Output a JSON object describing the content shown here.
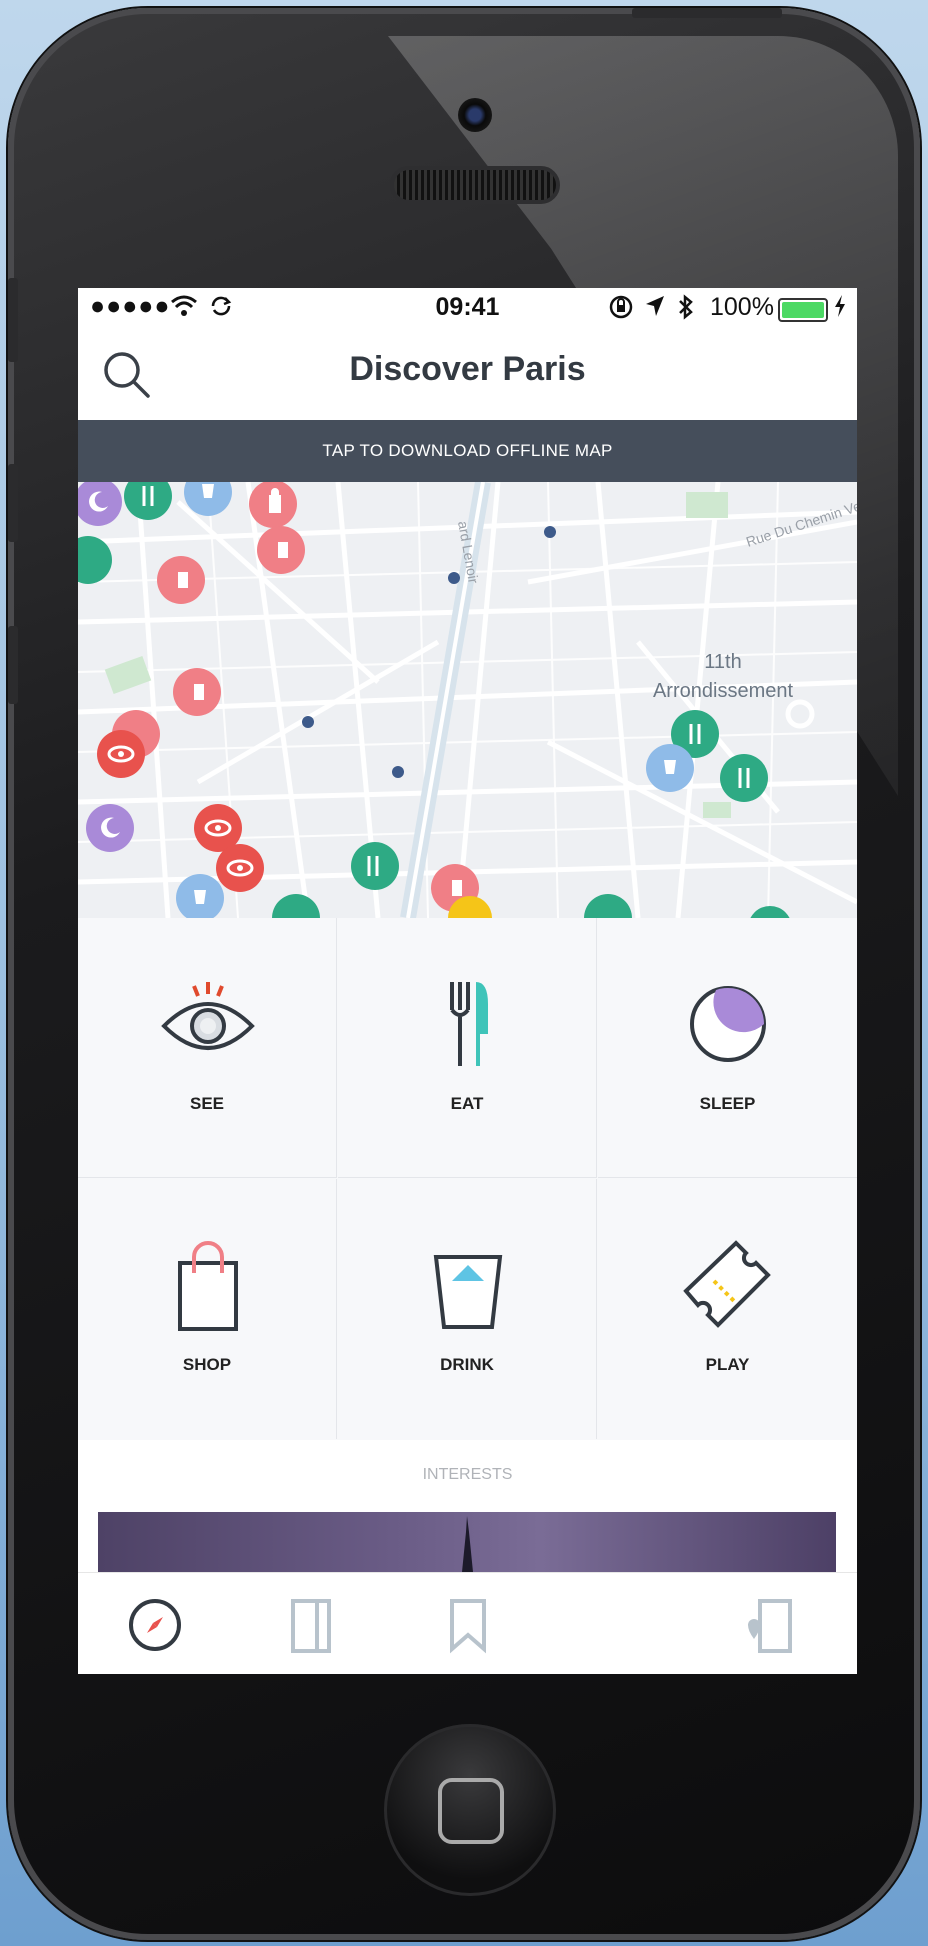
{
  "status_bar": {
    "signal": "●●●●●",
    "time": "09:41",
    "battery": "100%"
  },
  "header": {
    "title": "Discover Paris"
  },
  "banner": {
    "text": "TAP TO DOWNLOAD OFFLINE MAP"
  },
  "map": {
    "labels": {
      "district_line1": "11th",
      "district_line2": "Arrondissement",
      "street1": "Rue Du Chemin Ve",
      "street2": "ard Lenoir"
    },
    "colors": {
      "see": "#e8524d",
      "eat": "#2eaa84",
      "sleep": "#a98ad8",
      "shop": "#f07f86",
      "drink": "#8fbbe8"
    }
  },
  "categories": [
    {
      "label": "SEE",
      "icon": "eye-icon"
    },
    {
      "label": "EAT",
      "icon": "fork-knife-icon"
    },
    {
      "label": "SLEEP",
      "icon": "moon-icon"
    },
    {
      "label": "SHOP",
      "icon": "shopping-bag-icon"
    },
    {
      "label": "DRINK",
      "icon": "glass-icon"
    },
    {
      "label": "PLAY",
      "icon": "ticket-icon"
    }
  ],
  "interests": {
    "heading": "INTERESTS"
  },
  "tabbar": [
    {
      "icon": "compass-icon"
    },
    {
      "icon": "guide-book-icon"
    },
    {
      "icon": "bookmark-icon"
    },
    {
      "icon": "map-pin-book-icon"
    }
  ]
}
